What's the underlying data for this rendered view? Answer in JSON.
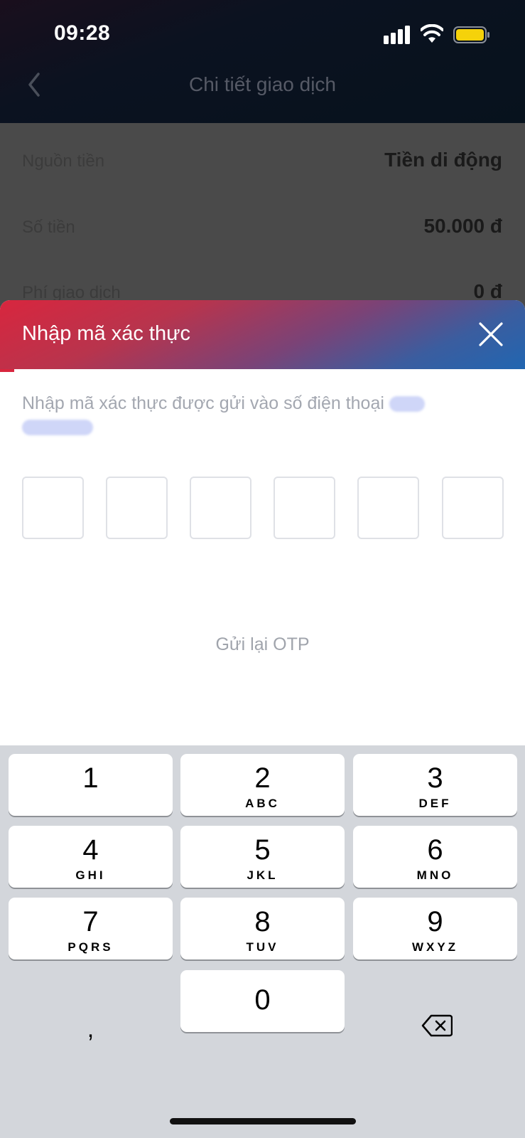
{
  "status_bar": {
    "time": "09:28",
    "icons": [
      "signal-icon",
      "wifi-icon",
      "battery-icon"
    ],
    "battery_color": "#f5d20a"
  },
  "nav": {
    "title": "Chi tiết giao dịch",
    "back_icon": "chevron-left-icon"
  },
  "background_details": [
    {
      "label": "Nguồn tiền",
      "value": "Tiền di động"
    },
    {
      "label": "Số tiền",
      "value": "50.000 đ"
    },
    {
      "label": "Phí giao dịch",
      "value": "0 đ"
    }
  ],
  "otp_sheet": {
    "title": "Nhập mã xác thực",
    "close_icon": "close-icon",
    "instruction": "Nhập mã xác thực được gửi vào số điện thoại",
    "code_length": 6,
    "resend_label": "Gửi lại OTP",
    "gradient_colors": [
      "#d8263e",
      "#2166b1"
    ]
  },
  "keypad": {
    "keys": [
      {
        "digit": "1",
        "letters": ""
      },
      {
        "digit": "2",
        "letters": "ABC"
      },
      {
        "digit": "3",
        "letters": "DEF"
      },
      {
        "digit": "4",
        "letters": "GHI"
      },
      {
        "digit": "5",
        "letters": "JKL"
      },
      {
        "digit": "6",
        "letters": "MNO"
      },
      {
        "digit": "7",
        "letters": "PQRS"
      },
      {
        "digit": "8",
        "letters": "TUV"
      },
      {
        "digit": "9",
        "letters": "WXYZ"
      },
      {
        "digit": "0",
        "letters": ""
      }
    ],
    "comma_label": ",",
    "backspace_icon": "backspace-icon"
  }
}
